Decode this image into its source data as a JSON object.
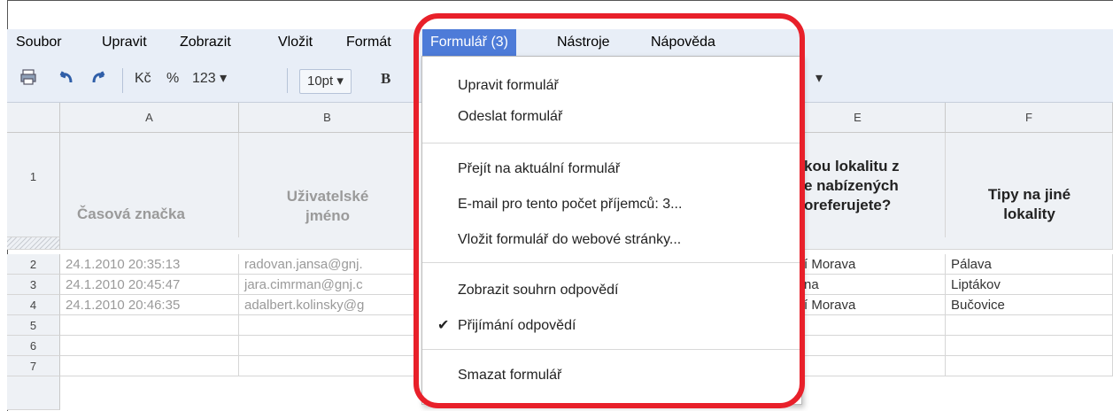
{
  "menubar": {
    "items": [
      "Soubor",
      "Upravit",
      "Zobrazit",
      "Vložit",
      "Formát",
      "Formulář (3)",
      "Nástroje",
      "Nápověda"
    ]
  },
  "toolbar": {
    "currency": "Kč",
    "percent": "%",
    "number_format": "123",
    "font_size": "10pt",
    "bold": "B",
    "dropdown_glyph": "▾"
  },
  "columns": [
    "A",
    "B",
    "E",
    "F"
  ],
  "header_row": {
    "row_num": "1",
    "a": "Časová značka",
    "b_line1": "Uživatelské",
    "b_line2": "jméno",
    "e_line1": "kou lokalitu z",
    "e_line2": "e nabízených",
    "e_line3": "oreferujete?",
    "f_line1": "Tipy na jiné",
    "f_line2": "lokality"
  },
  "rows": [
    {
      "num": "2",
      "a": "24.1.2010 20:35:13",
      "b": "radovan.jansa@gnj.",
      "e": "í Morava",
      "f": "Pálava"
    },
    {
      "num": "3",
      "a": "24.1.2010 20:45:47",
      "b": "jara.cimrman@gnj.c",
      "e": "na",
      "f": "Liptákov"
    },
    {
      "num": "4",
      "a": "24.1.2010 20:46:35",
      "b": "adalbert.kolinsky@g",
      "e": "í Morava",
      "f": "Bučovice"
    },
    {
      "num": "5",
      "a": "",
      "b": "",
      "e": "",
      "f": ""
    },
    {
      "num": "6",
      "a": "",
      "b": "",
      "e": "",
      "f": ""
    },
    {
      "num": "7",
      "a": "",
      "b": "",
      "e": "",
      "f": ""
    }
  ],
  "form_menu": {
    "edit": "Upravit formulář",
    "send": "Odeslat formulář",
    "goto_live": "Přejít na aktuální formulář",
    "email": "E-mail pro tento počet příjemců: 3...",
    "embed": "Vložit formulář do webové stránky...",
    "summary": "Zobrazit souhrn odpovědí",
    "accepting": "Přijímání odpovědí",
    "accepting_check": "✔",
    "delete": "Smazat formulář"
  },
  "colors": {
    "highlight": "#e8202a",
    "menu_active": "#4d7bd8",
    "menubar_bg": "#e8eef7"
  }
}
